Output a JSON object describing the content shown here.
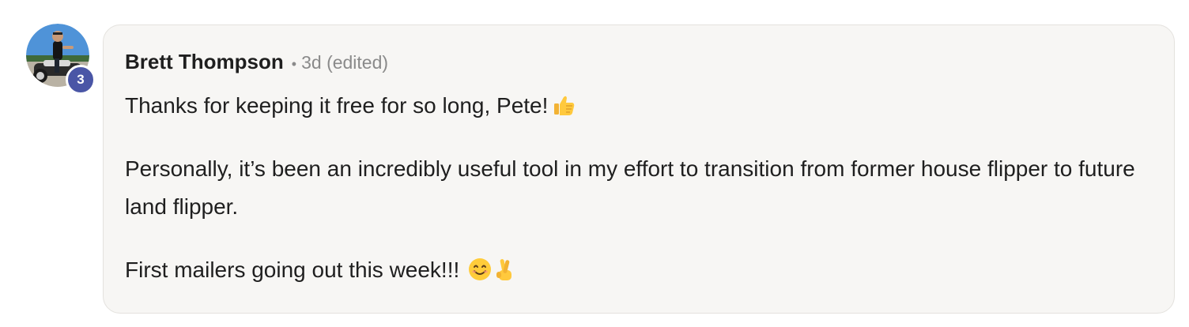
{
  "author": {
    "name": "Brett Thompson",
    "level_badge": "3",
    "avatar_icon": "user-avatar-photo"
  },
  "meta": {
    "separator": "•",
    "timestamp": "3d",
    "edited_label": "(edited)"
  },
  "comment": {
    "paragraph_1": "Thanks for keeping it free for so long, Pete!",
    "paragraph_1_emoji": "thumbs-up-icon",
    "paragraph_2": "Personally, it’s been an incredibly useful tool in my effort to transition from former house flipper to future land flipper.",
    "paragraph_3": "First mailers going out this week!!!",
    "paragraph_3_emojis": [
      "smiling-face-icon",
      "crossed-fingers-icon"
    ]
  },
  "colors": {
    "badge": "#4a56a6",
    "bubble_bg": "#f7f6f4",
    "bubble_border": "#e4e2de",
    "text": "#1f1f1f",
    "muted": "#8a8a8a"
  }
}
